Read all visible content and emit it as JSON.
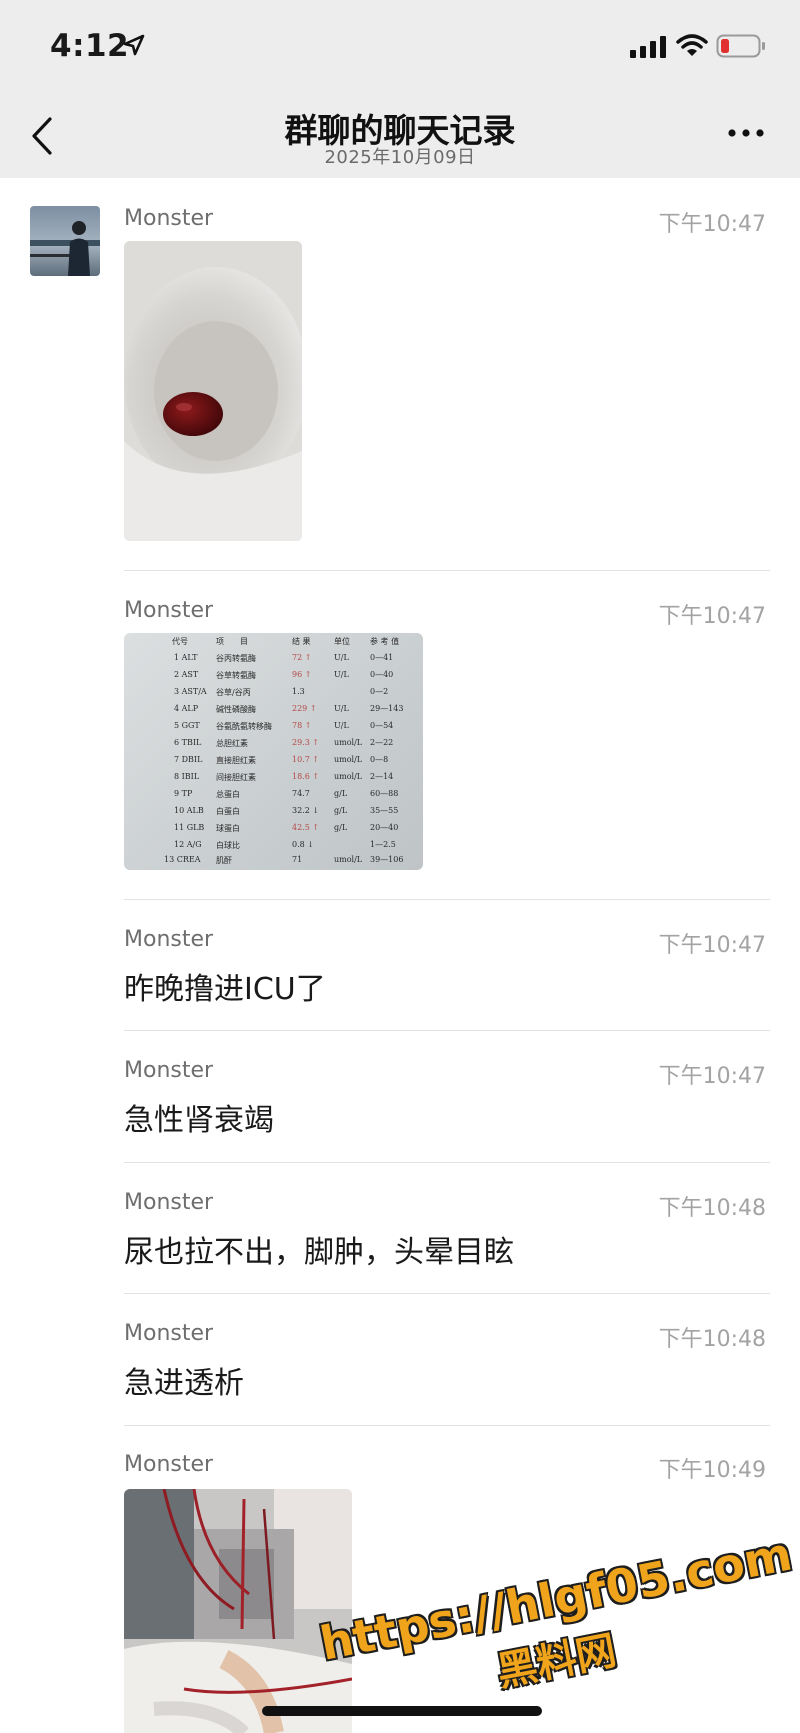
{
  "status_bar": {
    "time": "4:12"
  },
  "header": {
    "title": "群聊的聊天记录",
    "date": "2025年10月09日"
  },
  "messages": [
    {
      "sender": "Monster",
      "time": "下午10:47",
      "type": "image",
      "image_subject": "blood-clot-in-toilet"
    },
    {
      "sender": "Monster",
      "time": "下午10:47",
      "type": "image",
      "image_subject": "liver-function-lab-report"
    },
    {
      "sender": "Monster",
      "time": "下午10:47",
      "type": "text",
      "text": "昨晚撸进ICU了"
    },
    {
      "sender": "Monster",
      "time": "下午10:47",
      "type": "text",
      "text": "急性肾衰竭"
    },
    {
      "sender": "Monster",
      "time": "下午10:48",
      "type": "text",
      "text": "尿也拉不出，脚肿，头晕目眩"
    },
    {
      "sender": "Monster",
      "time": "下午10:48",
      "type": "text",
      "text": "急进透析"
    },
    {
      "sender": "Monster",
      "time": "下午10:49",
      "type": "image",
      "image_subject": "dialysis-machine-tubes"
    }
  ],
  "lab_report": {
    "headers": [
      "代号",
      "项　　目",
      "结 果",
      "单位",
      "参 考 值"
    ],
    "rows": [
      [
        "1  ALT",
        "谷丙转氨酶",
        "72 ↑",
        "U/L",
        "0—41"
      ],
      [
        "2  AST",
        "谷草转氨酶",
        "96 ↑",
        "U/L",
        "0—40"
      ],
      [
        "3  AST/A",
        "谷草/谷丙",
        "1.3",
        "",
        "0—2"
      ],
      [
        "4  ALP",
        "碱性磷酸酶",
        "229 ↑",
        "U/L",
        "29—143"
      ],
      [
        "5  GGT",
        "谷氨酰氨转移酶",
        "78 ↑",
        "U/L",
        "0—54"
      ],
      [
        "6  TBIL",
        "总胆红素",
        "29.3 ↑",
        "umol/L",
        "2—22"
      ],
      [
        "7  DBIL",
        "直接胆红素",
        "10.7 ↑",
        "umol/L",
        "0—8"
      ],
      [
        "8  IBIL",
        "间接胆红素",
        "18.6 ↑",
        "umol/L",
        "2—14"
      ],
      [
        "9  TP",
        "总蛋白",
        "74.7",
        "g/L",
        "60—88"
      ],
      [
        "10 ALB",
        "白蛋白",
        "32.2 ↓",
        "g/L",
        "35—55"
      ],
      [
        "11 GLB",
        "球蛋白",
        "42.5 ↑",
        "g/L",
        "20—40"
      ],
      [
        "12 A/G",
        "白球比",
        "0.8 ↓",
        "",
        "1—2.5"
      ],
      [
        "13 CREA",
        "肌酐",
        "71",
        "umol/L",
        "39—106"
      ]
    ]
  },
  "watermark": {
    "url": "https://hlgf05.com",
    "label": "黑料网"
  },
  "colors": {
    "header_bg": "#ededed",
    "divider": "#e3e3e3",
    "time_text": "#a3a3a3",
    "name_text": "#6e6e6e",
    "watermark": "#f0a41b"
  }
}
